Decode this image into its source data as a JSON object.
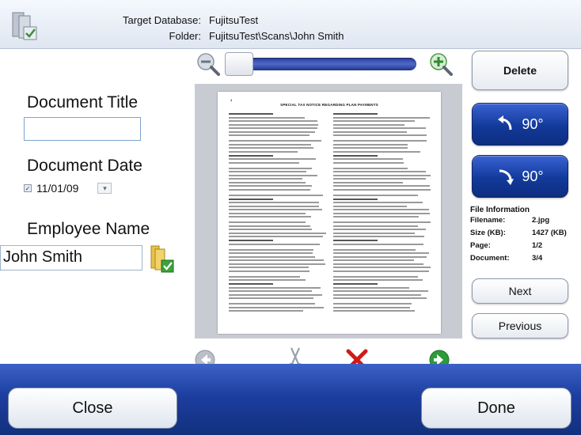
{
  "header": {
    "target_label": "Target Database:",
    "target_value": "FujitsuTest",
    "folder_label": "Folder:",
    "folder_value": "FujitsuTest\\Scans\\John Smith"
  },
  "form": {
    "title_label": "Document Title",
    "title_value": "",
    "date_label": "Document Date",
    "date_value": "11/01/09",
    "date_checked": true,
    "name_label": "Employee Name",
    "name_value": "John Smith"
  },
  "preview": {
    "doc_title": "SPECIAL TAX NOTICE REGARDING PLAN PAYMENTS",
    "doc_page_marker": "1",
    "zoom_level": 0.05
  },
  "actions": {
    "delete_label": "Delete",
    "rotate_left_label": "90°",
    "rotate_right_label": "90°",
    "next_label": "Next",
    "previous_label": "Previous",
    "close_label": "Close",
    "done_label": "Done"
  },
  "file_info": {
    "title": "File Information",
    "rows": [
      {
        "label": "Filename:",
        "value": "2.jpg"
      },
      {
        "label": "Size (KB):",
        "value": "1427 (KB)"
      },
      {
        "label": "Page:",
        "value": "1/2"
      },
      {
        "label": "Document:",
        "value": "3/4"
      }
    ]
  },
  "colors": {
    "accent_blue": "#1c3e9f",
    "zoom_track": "#3b55b8",
    "green_nav": "#2e9b3a",
    "delete_red": "#d11a1a"
  }
}
